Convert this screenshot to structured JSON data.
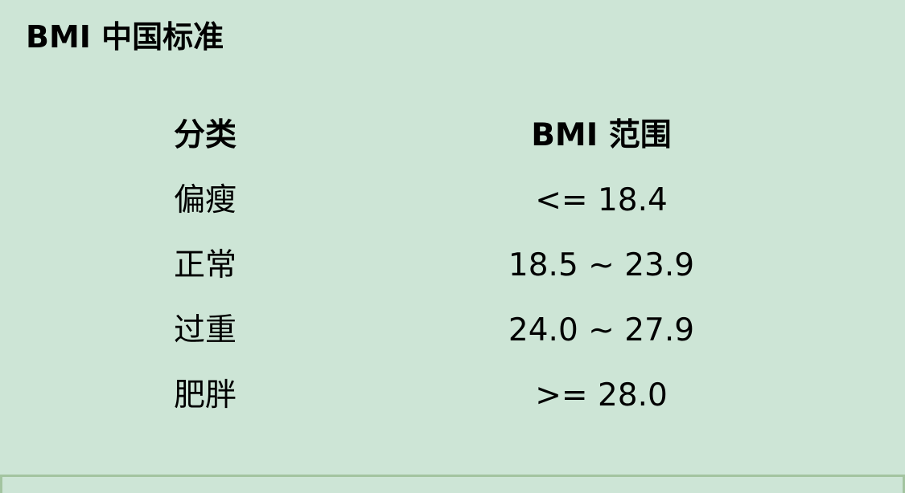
{
  "title": "BMI 中国标准",
  "table": {
    "headers": [
      "分类",
      "BMI 范围"
    ],
    "rows": [
      [
        "偏瘦",
        "<= 18.4"
      ],
      [
        "正常",
        "18.5 ~ 23.9"
      ],
      [
        "过重",
        "24.0 ~ 27.9"
      ],
      [
        "肥胖",
        ">= 28.0"
      ]
    ]
  },
  "colors": {
    "background": "#cde5d6",
    "border": "#a3c4a0"
  }
}
